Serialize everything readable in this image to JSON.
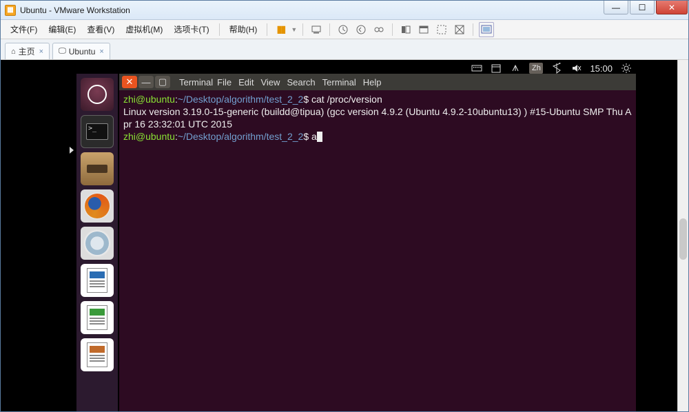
{
  "window": {
    "title": "Ubuntu - VMware Workstation"
  },
  "vm_menu": {
    "file": "文件(F)",
    "edit": "编辑(E)",
    "view": "查看(V)",
    "vm": "虚拟机(M)",
    "tabs": "选项卡(T)",
    "help": "帮助(H)"
  },
  "tabs": {
    "home": "主页",
    "guest": "Ubuntu"
  },
  "ubuntu_panel": {
    "ime": "Zh",
    "time": "15:00"
  },
  "terminal_menu": {
    "terminal1": "Terminal",
    "file": "File",
    "edit": "Edit",
    "view": "View",
    "search": "Search",
    "terminal2": "Terminal",
    "help": "Help"
  },
  "shell": {
    "prompt_user": "zhi@ubuntu",
    "prompt_sep": ":",
    "prompt_path": "~/Desktop/algorithm/test_2_2",
    "prompt_end": "$ ",
    "cmd1": "cat /proc/version",
    "out1": "Linux version 3.19.0-15-generic (buildd@tipua) (gcc version 4.9.2 (Ubuntu 4.9.2-10ubuntu13) ) #15-Ubuntu SMP Thu Apr 16 23:32:01 UTC 2015",
    "cmd2": "a"
  }
}
